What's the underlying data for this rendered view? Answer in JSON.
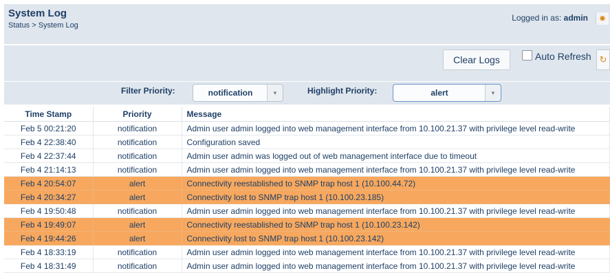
{
  "header": {
    "title": "System Log",
    "breadcrumb": "Status > System Log",
    "logged_in_label": "Logged in as:",
    "user": "admin",
    "gear_icon": "gear-icon"
  },
  "toolbar": {
    "clear_logs_label": "Clear Logs",
    "auto_refresh_label": "Auto Refresh",
    "auto_refresh_checked": false,
    "refresh_icon": "refresh-icon"
  },
  "filters": {
    "filter_label": "Filter Priority:",
    "filter_value": "notification",
    "highlight_label": "Highlight Priority:",
    "highlight_value": "alert"
  },
  "table": {
    "headers": [
      "Time Stamp",
      "Priority",
      "Message"
    ],
    "rows": [
      {
        "time": "Feb 5 00:21:20",
        "priority": "notification",
        "message": "Admin user admin logged into web management interface from 10.100.21.37 with privilege level read-write",
        "highlight": false
      },
      {
        "time": "Feb 4 22:38:40",
        "priority": "notification",
        "message": "Configuration saved",
        "highlight": false
      },
      {
        "time": "Feb 4 22:37:44",
        "priority": "notification",
        "message": "Admin user admin was logged out of web management interface due to timeout",
        "highlight": false
      },
      {
        "time": "Feb 4 21:14:13",
        "priority": "notification",
        "message": "Admin user admin logged into web management interface from 10.100.21.37 with privilege level read-write",
        "highlight": false
      },
      {
        "time": "Feb 4 20:54:07",
        "priority": "alert",
        "message": "Connectivity reestablished to SNMP trap host 1 (10.100.44.72)",
        "highlight": true
      },
      {
        "time": "Feb 4 20:34:27",
        "priority": "alert",
        "message": "Connectivity lost to SNMP trap host 1 (10.100.23.185)",
        "highlight": true
      },
      {
        "time": "Feb 4 19:50:48",
        "priority": "notification",
        "message": "Admin user admin logged into web management interface from 10.100.21.37 with privilege level read-write",
        "highlight": false
      },
      {
        "time": "Feb 4 19:49:07",
        "priority": "alert",
        "message": "Connectivity reestablished to SNMP trap host 1 (10.100.23.142)",
        "highlight": true
      },
      {
        "time": "Feb 4 19:44:26",
        "priority": "alert",
        "message": "Connectivity lost to SNMP trap host 1 (10.100.23.142)",
        "highlight": true
      },
      {
        "time": "Feb 4 18:33:19",
        "priority": "notification",
        "message": "Admin user admin logged into web management interface from 10.100.21.37 with privilege level read-write",
        "highlight": false
      },
      {
        "time": "Feb 4 18:31:49",
        "priority": "notification",
        "message": "Admin user admin logged into web management interface from 10.100.21.37 with privilege level read-write",
        "highlight": false
      }
    ]
  },
  "colors": {
    "highlight_row": "#f7a85e",
    "panel_bg": "#dfe6ed",
    "text": "#1f3f66"
  }
}
